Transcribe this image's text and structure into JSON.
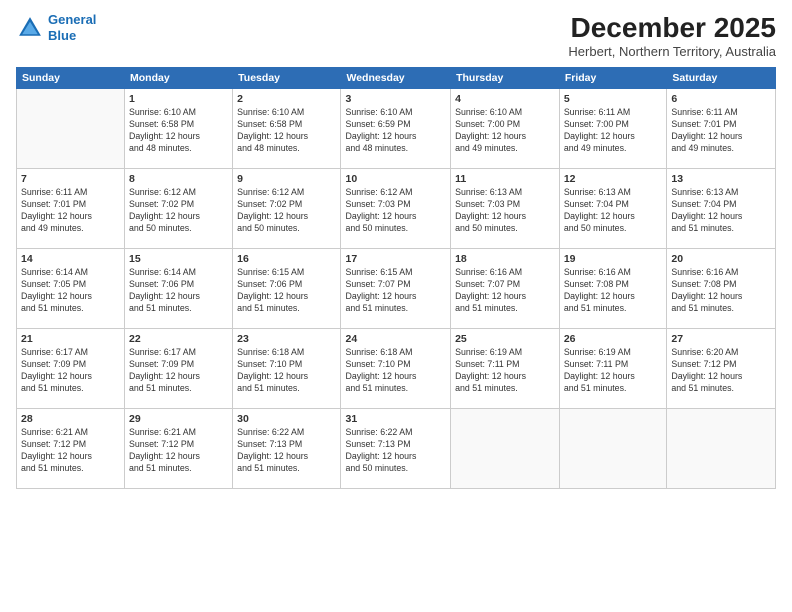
{
  "header": {
    "logo_line1": "General",
    "logo_line2": "Blue",
    "month": "December 2025",
    "location": "Herbert, Northern Territory, Australia"
  },
  "weekdays": [
    "Sunday",
    "Monday",
    "Tuesday",
    "Wednesday",
    "Thursday",
    "Friday",
    "Saturday"
  ],
  "weeks": [
    [
      {
        "day": "",
        "info": ""
      },
      {
        "day": "1",
        "info": "Sunrise: 6:10 AM\nSunset: 6:58 PM\nDaylight: 12 hours\nand 48 minutes."
      },
      {
        "day": "2",
        "info": "Sunrise: 6:10 AM\nSunset: 6:58 PM\nDaylight: 12 hours\nand 48 minutes."
      },
      {
        "day": "3",
        "info": "Sunrise: 6:10 AM\nSunset: 6:59 PM\nDaylight: 12 hours\nand 48 minutes."
      },
      {
        "day": "4",
        "info": "Sunrise: 6:10 AM\nSunset: 7:00 PM\nDaylight: 12 hours\nand 49 minutes."
      },
      {
        "day": "5",
        "info": "Sunrise: 6:11 AM\nSunset: 7:00 PM\nDaylight: 12 hours\nand 49 minutes."
      },
      {
        "day": "6",
        "info": "Sunrise: 6:11 AM\nSunset: 7:01 PM\nDaylight: 12 hours\nand 49 minutes."
      }
    ],
    [
      {
        "day": "7",
        "info": "Sunrise: 6:11 AM\nSunset: 7:01 PM\nDaylight: 12 hours\nand 49 minutes."
      },
      {
        "day": "8",
        "info": "Sunrise: 6:12 AM\nSunset: 7:02 PM\nDaylight: 12 hours\nand 50 minutes."
      },
      {
        "day": "9",
        "info": "Sunrise: 6:12 AM\nSunset: 7:02 PM\nDaylight: 12 hours\nand 50 minutes."
      },
      {
        "day": "10",
        "info": "Sunrise: 6:12 AM\nSunset: 7:03 PM\nDaylight: 12 hours\nand 50 minutes."
      },
      {
        "day": "11",
        "info": "Sunrise: 6:13 AM\nSunset: 7:03 PM\nDaylight: 12 hours\nand 50 minutes."
      },
      {
        "day": "12",
        "info": "Sunrise: 6:13 AM\nSunset: 7:04 PM\nDaylight: 12 hours\nand 50 minutes."
      },
      {
        "day": "13",
        "info": "Sunrise: 6:13 AM\nSunset: 7:04 PM\nDaylight: 12 hours\nand 51 minutes."
      }
    ],
    [
      {
        "day": "14",
        "info": "Sunrise: 6:14 AM\nSunset: 7:05 PM\nDaylight: 12 hours\nand 51 minutes."
      },
      {
        "day": "15",
        "info": "Sunrise: 6:14 AM\nSunset: 7:06 PM\nDaylight: 12 hours\nand 51 minutes."
      },
      {
        "day": "16",
        "info": "Sunrise: 6:15 AM\nSunset: 7:06 PM\nDaylight: 12 hours\nand 51 minutes."
      },
      {
        "day": "17",
        "info": "Sunrise: 6:15 AM\nSunset: 7:07 PM\nDaylight: 12 hours\nand 51 minutes."
      },
      {
        "day": "18",
        "info": "Sunrise: 6:16 AM\nSunset: 7:07 PM\nDaylight: 12 hours\nand 51 minutes."
      },
      {
        "day": "19",
        "info": "Sunrise: 6:16 AM\nSunset: 7:08 PM\nDaylight: 12 hours\nand 51 minutes."
      },
      {
        "day": "20",
        "info": "Sunrise: 6:16 AM\nSunset: 7:08 PM\nDaylight: 12 hours\nand 51 minutes."
      }
    ],
    [
      {
        "day": "21",
        "info": "Sunrise: 6:17 AM\nSunset: 7:09 PM\nDaylight: 12 hours\nand 51 minutes."
      },
      {
        "day": "22",
        "info": "Sunrise: 6:17 AM\nSunset: 7:09 PM\nDaylight: 12 hours\nand 51 minutes."
      },
      {
        "day": "23",
        "info": "Sunrise: 6:18 AM\nSunset: 7:10 PM\nDaylight: 12 hours\nand 51 minutes."
      },
      {
        "day": "24",
        "info": "Sunrise: 6:18 AM\nSunset: 7:10 PM\nDaylight: 12 hours\nand 51 minutes."
      },
      {
        "day": "25",
        "info": "Sunrise: 6:19 AM\nSunset: 7:11 PM\nDaylight: 12 hours\nand 51 minutes."
      },
      {
        "day": "26",
        "info": "Sunrise: 6:19 AM\nSunset: 7:11 PM\nDaylight: 12 hours\nand 51 minutes."
      },
      {
        "day": "27",
        "info": "Sunrise: 6:20 AM\nSunset: 7:12 PM\nDaylight: 12 hours\nand 51 minutes."
      }
    ],
    [
      {
        "day": "28",
        "info": "Sunrise: 6:21 AM\nSunset: 7:12 PM\nDaylight: 12 hours\nand 51 minutes."
      },
      {
        "day": "29",
        "info": "Sunrise: 6:21 AM\nSunset: 7:12 PM\nDaylight: 12 hours\nand 51 minutes."
      },
      {
        "day": "30",
        "info": "Sunrise: 6:22 AM\nSunset: 7:13 PM\nDaylight: 12 hours\nand 51 minutes."
      },
      {
        "day": "31",
        "info": "Sunrise: 6:22 AM\nSunset: 7:13 PM\nDaylight: 12 hours\nand 50 minutes."
      },
      {
        "day": "",
        "info": ""
      },
      {
        "day": "",
        "info": ""
      },
      {
        "day": "",
        "info": ""
      }
    ]
  ]
}
